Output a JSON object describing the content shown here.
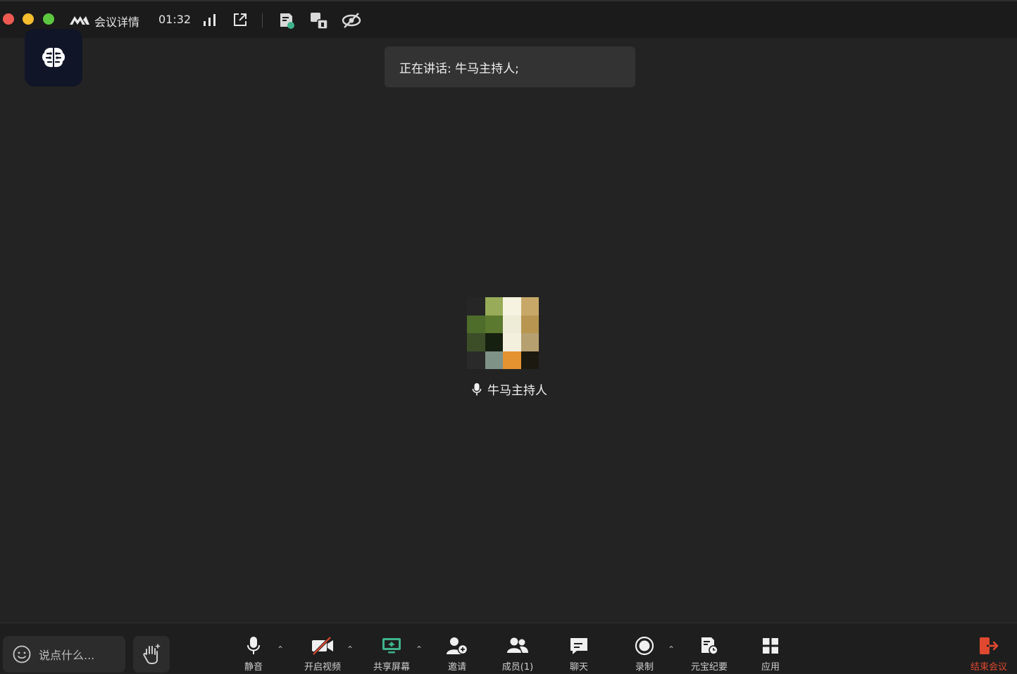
{
  "window": {
    "title": "会议详情",
    "timer": "01:32"
  },
  "banner": {
    "speaking_text": "正在讲话: 牛马主持人;"
  },
  "participant": {
    "name": "牛马主持人",
    "avatar_pixels": [
      [
        "#262626",
        "#97ab58",
        "#f6f4e1",
        "#c8a868"
      ],
      [
        "#4e6d2b",
        "#5c7a2f",
        "#eeecd6",
        "#b89550"
      ],
      [
        "#3c4e28",
        "#162010",
        "#f3f0dd",
        "#b7a070"
      ],
      [
        "#2a2a2a",
        "#7f9288",
        "#e59230",
        "#1c1a10"
      ]
    ]
  },
  "toolbar": {
    "chat_placeholder": "说点什么...",
    "items": [
      {
        "label": "静音",
        "icon": "microphone-icon"
      },
      {
        "label": "开启视频",
        "icon": "video-off-icon"
      },
      {
        "label": "共享屏幕",
        "icon": "share-screen-icon"
      },
      {
        "label": "邀请",
        "icon": "invite-user-icon"
      },
      {
        "label": "成员(1)",
        "icon": "members-icon"
      },
      {
        "label": "聊天",
        "icon": "chat-icon"
      },
      {
        "label": "录制",
        "icon": "record-icon"
      },
      {
        "label": "元宝纪要",
        "icon": "meeting-notes-icon"
      },
      {
        "label": "应用",
        "icon": "apps-icon"
      },
      {
        "label": "结束会议",
        "icon": "leave-meeting-icon"
      }
    ]
  },
  "colors": {
    "background": "#232323",
    "titlebar": "#1b1b1b",
    "toolbar": "#1e1e1e",
    "share_accent": "#3fb38a",
    "end_meeting": "#e0492f",
    "ai_badge": "#111528"
  }
}
